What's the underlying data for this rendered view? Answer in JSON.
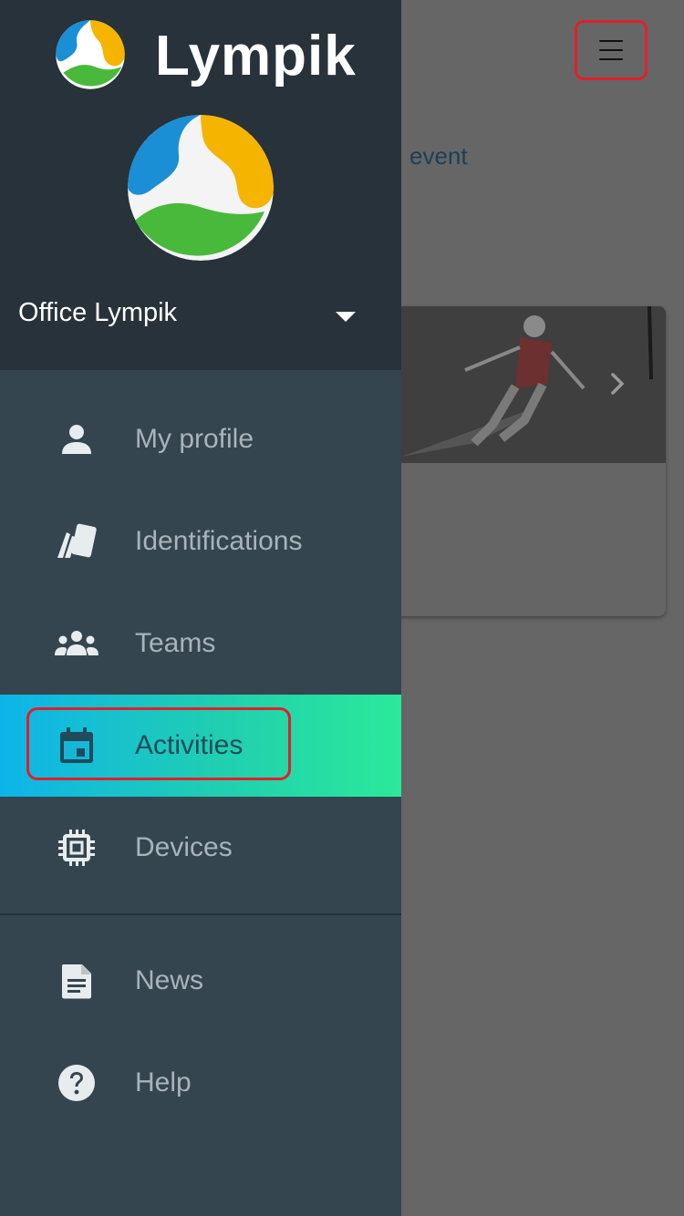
{
  "app": {
    "brand_name": "Lympik"
  },
  "drawer": {
    "account_name": "Office Lympik",
    "nav_items": [
      {
        "label": "My profile",
        "icon": "person-icon"
      },
      {
        "label": "Identifications",
        "icon": "cards-icon"
      },
      {
        "label": "Teams",
        "icon": "group-icon"
      },
      {
        "label": "Activities",
        "icon": "calendar-icon",
        "active": true
      },
      {
        "label": "Devices",
        "icon": "chip-icon"
      },
      {
        "label": "News",
        "icon": "document-icon"
      },
      {
        "label": "Help",
        "icon": "help-icon"
      }
    ]
  },
  "background": {
    "event_link": "event"
  },
  "colors": {
    "drawer_bg": "#35454f",
    "header_bg": "#28323a",
    "active_gradient_start": "#0db4ea",
    "active_gradient_end": "#2be99a",
    "highlight_outline": "#e0202a"
  }
}
